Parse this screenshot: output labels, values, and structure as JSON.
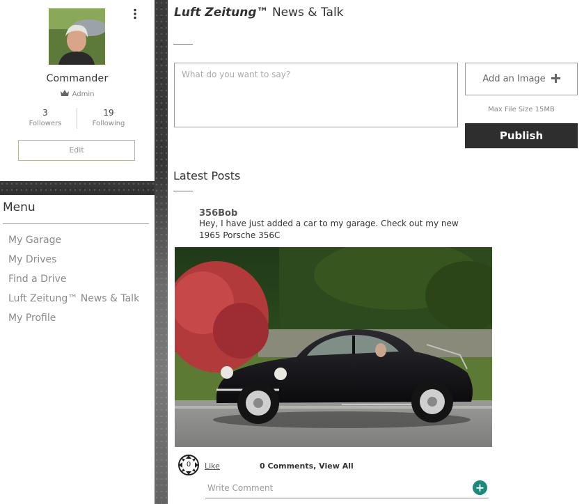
{
  "profile": {
    "name": "Commander",
    "role": "Admin",
    "followers_count": "3",
    "followers_label": "Followers",
    "following_count": "19",
    "following_label": "Following",
    "edit_label": "Edit",
    "more_icon": "kebab-icon"
  },
  "menu": {
    "title": "Menu",
    "items": [
      {
        "label": "My Garage"
      },
      {
        "label": "My Drives"
      },
      {
        "label": "Find a Drive"
      },
      {
        "label": "Luft Zeitung™ News & Talk"
      },
      {
        "label": "My Profile"
      }
    ]
  },
  "main": {
    "title_brand": "Luft Zeitung™",
    "title_rest": " News & Talk",
    "composer_placeholder": "What do you want to say?",
    "add_image_label": "Add an Image",
    "max_file_size": "Max File Size 15MB",
    "publish_label": "Publish",
    "latest_label": "Latest Posts"
  },
  "post": {
    "author": "356Bob",
    "text": "Hey, I have just added a car to my garage. Check out my new 1965 Porsche 356C",
    "reaction_count": "0",
    "like_label": "Like",
    "comments_label": "0 Comments, ",
    "view_all_label": "View All",
    "comment_placeholder": "Write Comment"
  },
  "colors": {
    "publish_bg": "#2e2e2e",
    "add_comment_bg": "#1a8a7a"
  }
}
